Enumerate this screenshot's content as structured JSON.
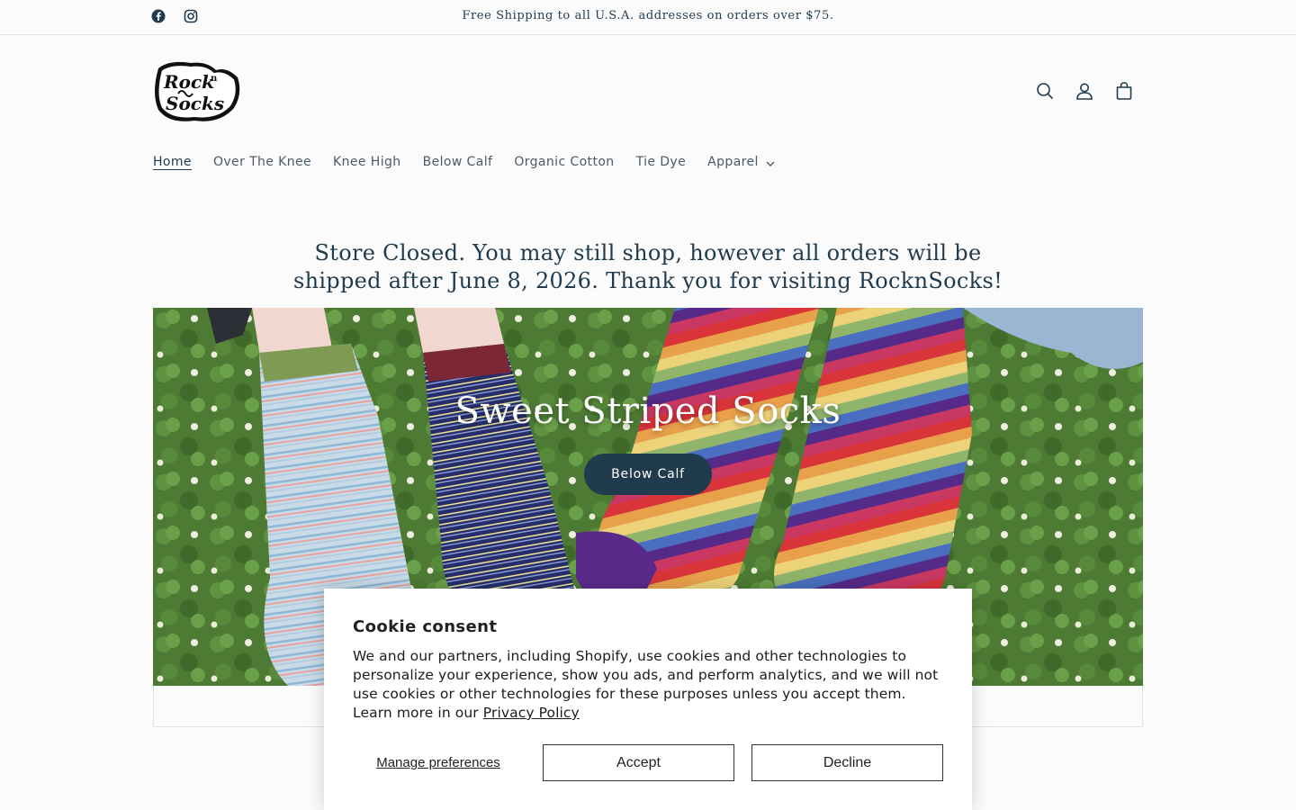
{
  "announcement": {
    "text": "Free Shipping to all U.S.A. addresses on orders over $75.",
    "social": [
      {
        "icon": "facebook-icon"
      },
      {
        "icon": "instagram-icon"
      }
    ]
  },
  "header": {
    "logo_text": "Rock'n Socks",
    "icons": [
      "search-icon",
      "account-icon",
      "cart-icon"
    ]
  },
  "nav": {
    "items": [
      {
        "label": "Home",
        "active": true
      },
      {
        "label": "Over The Knee"
      },
      {
        "label": "Knee High"
      },
      {
        "label": "Below Calf"
      },
      {
        "label": "Organic Cotton"
      },
      {
        "label": "Tie Dye"
      },
      {
        "label": "Apparel",
        "dropdown": true
      }
    ]
  },
  "notice": {
    "line1": "Store Closed. You may still shop, however all orders will be",
    "line2": "shipped after June 8, 2026. Thank you for visiting RocknSocks!"
  },
  "hero": {
    "title": "Sweet Striped Socks",
    "button_label": "Below Calf"
  },
  "cookie": {
    "title": "Cookie consent",
    "body": "We and our partners, including Shopify, use cookies and other technologies to personalize your experience, show you ads, and perform analytics, and we will not use cookies or other technologies for these purposes unless you accept them. Learn more in our",
    "privacy_link": "Privacy Policy",
    "manage_label": "Manage preferences",
    "accept_label": "Accept",
    "decline_label": "Decline"
  },
  "colors": {
    "brand_dark": "#1f3b4d",
    "background": "#fbfbfb"
  }
}
